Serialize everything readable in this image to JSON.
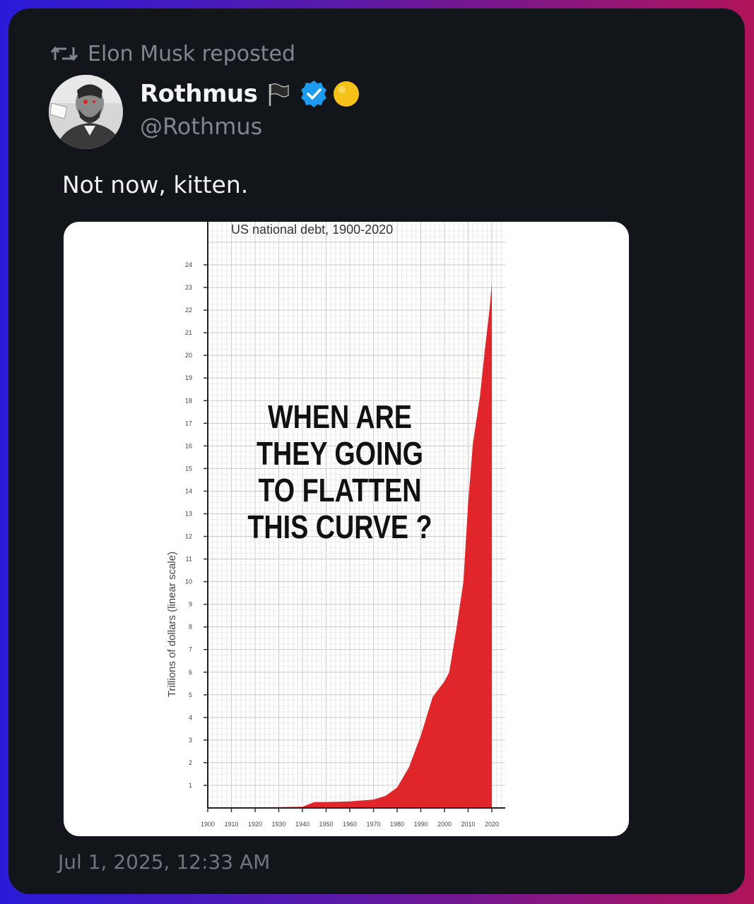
{
  "repost": {
    "icon": "repost-icon",
    "label": "Elon Musk reposted"
  },
  "author": {
    "name": "Rothmus",
    "handle": "@Rothmus",
    "badges": [
      "black-flag-icon",
      "verified-badge-icon",
      "yellow-circle-icon"
    ],
    "verified_color": "#1d9bf0"
  },
  "tweet": {
    "text": "Not now, kitten."
  },
  "timestamp": "Jul 1, 2025, 12:33 AM",
  "meme": {
    "overlay_lines": [
      "WHEN ARE",
      "THEY GOING",
      "TO FLATTEN",
      "THIS CURVE ?"
    ]
  },
  "chart_data": {
    "type": "area",
    "title": "US national debt, 1900-2020",
    "xlabel": "",
    "ylabel": "Trillions of dollars (linear scale)",
    "xlim": [
      1900,
      2020
    ],
    "ylim": [
      0,
      25
    ],
    "x_ticks": [
      1900,
      1910,
      1920,
      1930,
      1940,
      1950,
      1960,
      1970,
      1980,
      1990,
      2000,
      2010,
      2020
    ],
    "y_ticks": [
      1,
      2,
      3,
      4,
      5,
      6,
      7,
      8,
      9,
      10,
      11,
      12,
      13,
      14,
      15,
      16,
      17,
      18,
      19,
      20,
      21,
      22,
      23,
      24
    ],
    "grid": true,
    "fill_color": "#e0262b",
    "series": [
      {
        "x": [
          1900,
          1940,
          1945,
          1950,
          1960,
          1970,
          1975,
          1980,
          1985,
          1990,
          1995,
          2000,
          2002,
          2005,
          2008,
          2010,
          2012,
          2015,
          2017,
          2019,
          2020
        ],
        "values": [
          0.0,
          0.05,
          0.26,
          0.26,
          0.29,
          0.37,
          0.53,
          0.9,
          1.8,
          3.2,
          4.9,
          5.6,
          6.0,
          7.9,
          10.0,
          13.5,
          16.1,
          18.2,
          20.2,
          22.0,
          23.2
        ]
      }
    ]
  }
}
